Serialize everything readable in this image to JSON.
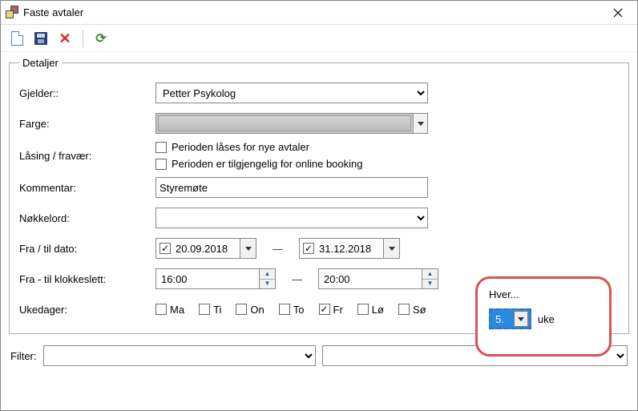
{
  "window": {
    "title": "Faste avtaler"
  },
  "toolbar": {
    "new": "Ny",
    "save": "Lagre",
    "delete": "Slett",
    "refresh": "Oppdater"
  },
  "details": {
    "legend": "Detaljer",
    "gjelder_label": "Gjelder::",
    "gjelder_value": "Petter Psykolog",
    "farge_label": "Farge:",
    "laasing_label": "Låsing / fravær:",
    "laas_nye": "Perioden låses for nye avtaler",
    "online_booking": "Perioden er tilgjengelig for online booking",
    "kommentar_label": "Kommentar:",
    "kommentar_value": "Styremøte",
    "nokkelord_label": "Nøkkelord:",
    "nokkelord_value": "",
    "fratil_dato_label": "Fra / til dato:",
    "fra_dato": "20.09.2018",
    "til_dato": "31.12.2018",
    "fratil_klokke_label": "Fra - til klokkeslett:",
    "fra_tid": "16:00",
    "til_tid": "20:00",
    "ukedager_label": "Ukedager:",
    "days": [
      "Ma",
      "Ti",
      "On",
      "To",
      "Fr",
      "Lø",
      "Sø"
    ],
    "days_checked": [
      false,
      false,
      false,
      false,
      true,
      false,
      false
    ]
  },
  "hver": {
    "label": "Hver...",
    "value": "5.",
    "unit": "uke"
  },
  "filter": {
    "label": "Filter:"
  }
}
